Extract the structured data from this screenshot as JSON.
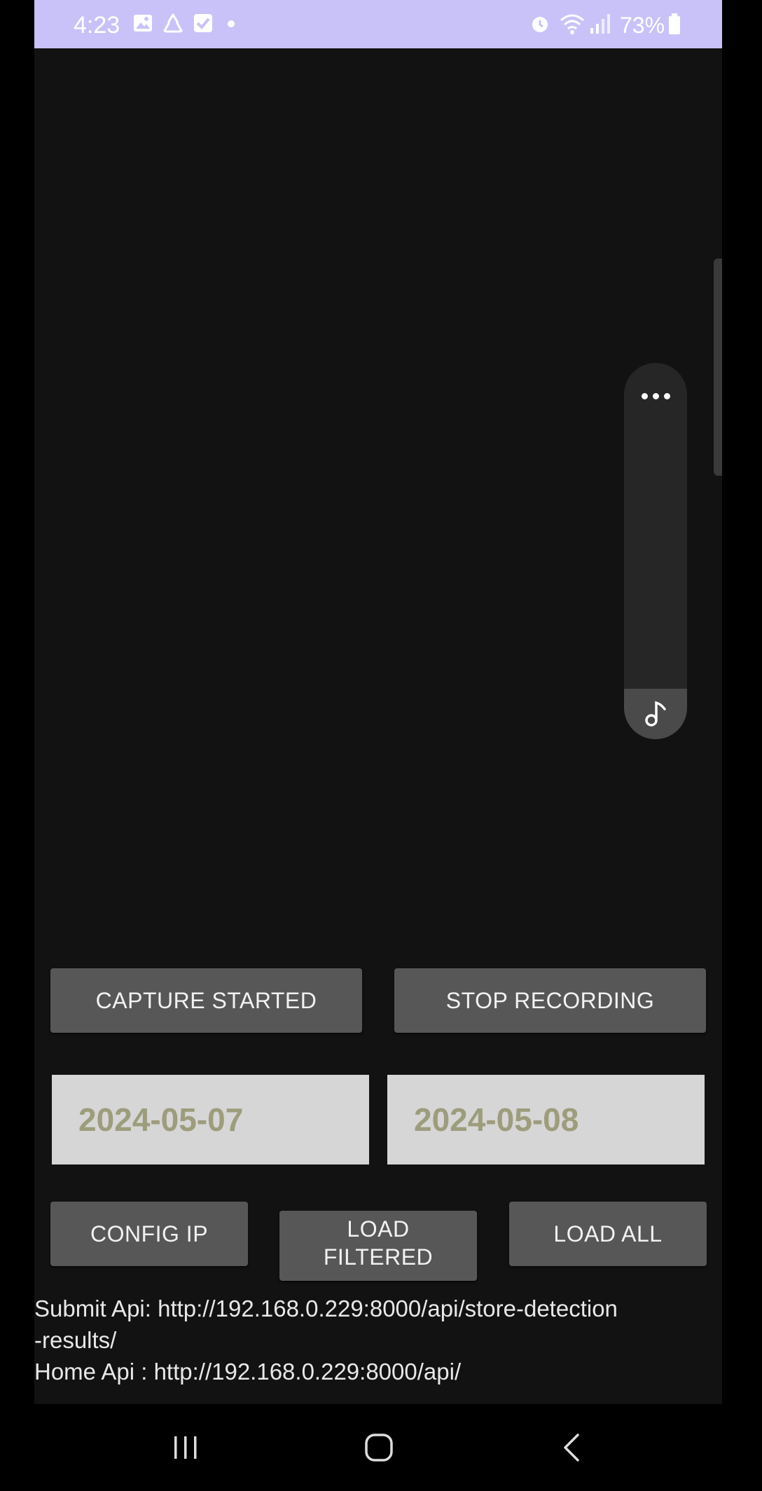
{
  "status_bar": {
    "time": "4:23",
    "battery": "73%",
    "icons_left": [
      "gallery-icon",
      "recycle-icon",
      "check-icon",
      "dot-icon"
    ],
    "icons_right": [
      "alarm-icon",
      "wifi-icon",
      "signal-icon",
      "battery-icon"
    ]
  },
  "panel": {
    "icons": [
      "more-dots-icon",
      "music-note-icon"
    ]
  },
  "buttons": {
    "capture": "CAPTURE STARTED",
    "stop": "STOP RECORDING",
    "config": "CONFIG IP",
    "filtered_line1": "LOAD",
    "filtered_line2": "FILTERED",
    "load_all": "LOAD ALL"
  },
  "dates": {
    "from": "2024-05-07",
    "to": "2024-05-08"
  },
  "api": {
    "submit_line1": "Submit Api: http://192.168.0.229:8000/api/store-detection",
    "submit_line2": "-results/",
    "home": "Home Api : http://192.168.0.229:8000/api/"
  },
  "nav": {
    "icons": [
      "recent-apps-icon",
      "home-icon",
      "back-icon"
    ]
  },
  "colors": {
    "status_bar": "#c9c2f9",
    "background": "#121212",
    "button": "#575757",
    "date_field": "#d6d6d6",
    "date_text": "#9d9c7c"
  }
}
